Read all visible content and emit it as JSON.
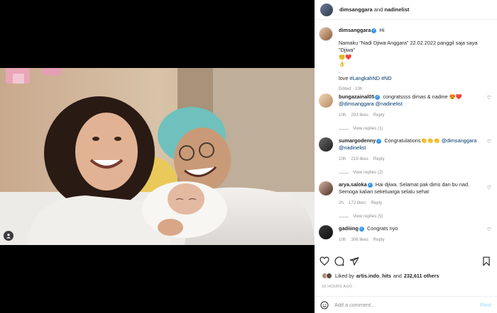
{
  "header": {
    "user1": "dimsanggara",
    "and": "and",
    "user2": "nadinelist"
  },
  "post": {
    "username": "dimsanggara",
    "greeting": "Hi",
    "line1": "Namaku \"Nadi Djiwa Anggara\" 22.02.2022 panggil saja saya \"Djiwa\"",
    "emoji_line1": "😚❤️",
    "emoji_line2": "👌",
    "dot": ".",
    "love": "love",
    "tag1": "#LangkahND",
    "tag2": "#ND",
    "edited": "Edited · 10h"
  },
  "comments": [
    {
      "username": "bungazainal05",
      "text": "congratssss dimas & nadine 😍❤️",
      "mention1": "@dimsanggara",
      "mention2": "@nadinelist",
      "age": "10h",
      "likes": "293 likes",
      "reply": "Reply",
      "view_replies": "View replies (1)"
    },
    {
      "username": "sumargodenny",
      "text": "Congratulations👏👏👏",
      "mention1": "@dimsanggara",
      "mention2": "@nadinelist",
      "age": "10h",
      "likes": "219 likes",
      "reply": "Reply",
      "view_replies": "View replies (2)"
    },
    {
      "username": "arya.saloka",
      "text": "Hai djiwa. Selamat pak dims dan bu nad. Semoga kalian sekeluarga selalu sehat",
      "age": "2h",
      "likes": "172 likes",
      "reply": "Reply",
      "view_replies": "View replies (5)"
    },
    {
      "username": "gadiiing",
      "text": "Congrats nyo",
      "age": "10h",
      "likes": "306 likes",
      "reply": "Reply"
    }
  ],
  "likes": {
    "prefix": "Liked by",
    "user": "artis.indo_hits",
    "middle": "and",
    "count": "232,611 others"
  },
  "time_ago": "10 HOURS AGO",
  "add_comment": {
    "placeholder": "Add a comment...",
    "post_label": "Post"
  },
  "icons": {
    "like": "heart-icon",
    "comment": "comment-icon",
    "share": "share-icon",
    "save": "bookmark-icon",
    "emoji": "emoji-icon",
    "tags": "user-tag-icon"
  },
  "colors": {
    "link": "#00376b",
    "verified": "#3897f0",
    "muted": "#8e8e8e",
    "post_button": "#b2dffc"
  }
}
